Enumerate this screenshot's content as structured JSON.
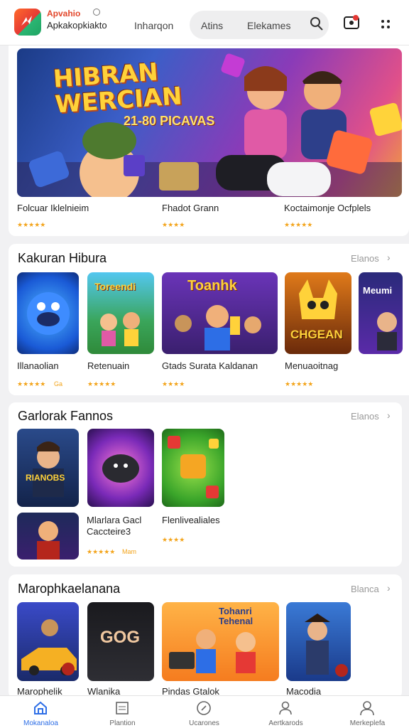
{
  "header": {
    "app_name": "Apvahio",
    "app_subtitle": "Apkakopkiakto",
    "nav_link": "Inharqon",
    "pill_items": [
      "Atins",
      "Elekames"
    ]
  },
  "featured": {
    "banner_title": "HIBRAN WERCIAN",
    "banner_badge": "21-80 PICAVAS",
    "items": [
      {
        "title": "Folcuar Iklelnieim",
        "rating_stars": "★★★★★"
      },
      {
        "title": "Fhadot Grann",
        "rating_stars": "★★★★"
      },
      {
        "title": "Koctaimonje Ocfplels",
        "rating_stars": "★★★★★"
      }
    ]
  },
  "section1": {
    "title": "Kakuran Hibura",
    "more": "Elanos",
    "items": [
      {
        "title": "Illanaolian",
        "rating_stars": "★★★★★",
        "extra": "Ga"
      },
      {
        "title": "Retenuain",
        "rating_stars": "★★★★★"
      },
      {
        "title": "Gtads Surata Kaldanan",
        "rating_stars": "★★★★"
      },
      {
        "title": "Menuaoitnag",
        "rating_stars": "★★★★★"
      }
    ],
    "tile_texts": [
      "Toreendi",
      "Toanhk",
      "CHGEAN",
      "Meumi"
    ]
  },
  "section2": {
    "title": "Garlorak Fannos",
    "more": "Elanos",
    "tile_texts": [
      "RIANOBS"
    ],
    "list_items": [
      {
        "title": "Mlarlara Gacl Caccteire3",
        "rating_stars": "★★★★★",
        "extra": "Mam"
      },
      {
        "title": "Flenlivealiales",
        "rating_stars": "★★★★"
      }
    ]
  },
  "section3": {
    "title": "Marophkaelanana",
    "more": "Blanca",
    "items": [
      {
        "title": "Marophelik"
      },
      {
        "title": "Wlanika"
      },
      {
        "title": "Pindas Gtalok"
      },
      {
        "title": "Macodia"
      }
    ],
    "tile_texts": [
      "GOG",
      "Tohanri Tehenal"
    ]
  },
  "bottom_nav": [
    {
      "label": "Mokanaloa",
      "icon": "home-icon",
      "active": true
    },
    {
      "label": "Plantion",
      "icon": "calendar-icon",
      "active": false
    },
    {
      "label": "Ucarones",
      "icon": "compass-icon",
      "active": false
    },
    {
      "label": "Aertkarods",
      "icon": "person-icon",
      "active": false
    },
    {
      "label": "Merkeplefa",
      "icon": "profile-icon",
      "active": false
    }
  ],
  "colors": {
    "accent": "#2d6ee6",
    "brand": "#e2462a",
    "star": "#f3a41b"
  }
}
